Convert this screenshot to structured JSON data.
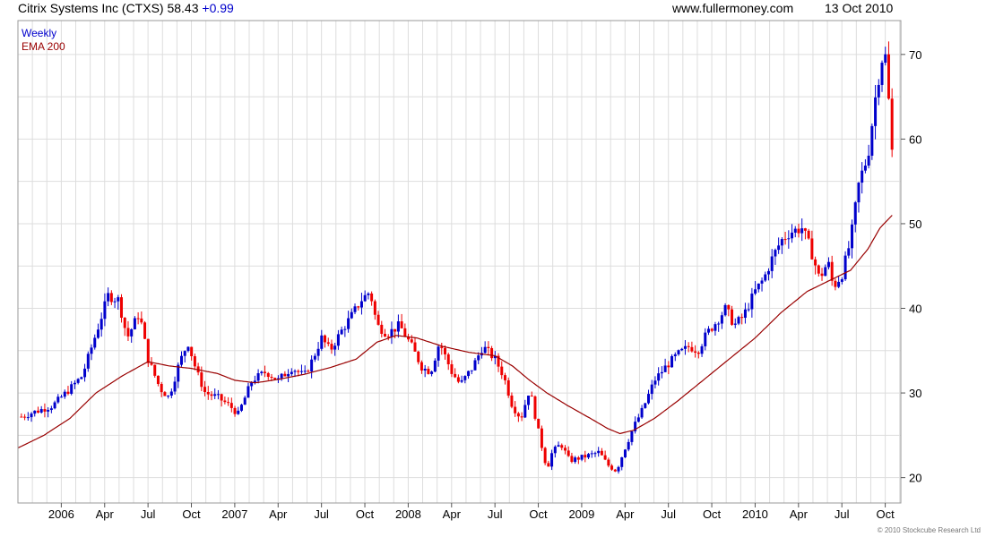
{
  "header": {
    "title": "Citrix Systems Inc (CTXS) 58.43",
    "change": "+0.99",
    "site": "www.fullermoney.com",
    "date": "13 Oct 2010"
  },
  "footer": {
    "copyright": "© 2010 Stockcube Research Ltd"
  },
  "colors": {
    "up": "#0000cc",
    "down": "#ee0000",
    "ema": "#990000",
    "grid": "#dddddd"
  },
  "chart_data": {
    "type": "candlestick",
    "legend": [
      "Weekly",
      "EMA 200"
    ],
    "legend_position": "top-left",
    "grid": true,
    "ylim": [
      17,
      74
    ],
    "y_ticks": [
      20,
      30,
      40,
      50,
      60,
      70
    ],
    "xlim": [
      2005.75,
      2010.84
    ],
    "x_ticks": [
      {
        "label": "2006",
        "x": 2006.0
      },
      {
        "label": "Apr",
        "x": 2006.25
      },
      {
        "label": "Jul",
        "x": 2006.5
      },
      {
        "label": "Oct",
        "x": 2006.75
      },
      {
        "label": "2007",
        "x": 2007.0
      },
      {
        "label": "Apr",
        "x": 2007.25
      },
      {
        "label": "Jul",
        "x": 2007.5
      },
      {
        "label": "Oct",
        "x": 2007.75
      },
      {
        "label": "2008",
        "x": 2008.0
      },
      {
        "label": "Apr",
        "x": 2008.25
      },
      {
        "label": "Jul",
        "x": 2008.5
      },
      {
        "label": "Oct",
        "x": 2008.75
      },
      {
        "label": "2009",
        "x": 2009.0
      },
      {
        "label": "Apr",
        "x": 2009.25
      },
      {
        "label": "Jul",
        "x": 2009.5
      },
      {
        "label": "Oct",
        "x": 2009.75
      },
      {
        "label": "2010",
        "x": 2010.0
      },
      {
        "label": "Apr",
        "x": 2010.25
      },
      {
        "label": "Jul",
        "x": 2010.5
      },
      {
        "label": "Oct",
        "x": 2010.75
      }
    ],
    "price_keypoints": [
      [
        2005.77,
        27.2
      ],
      [
        2005.85,
        27.8
      ],
      [
        2005.95,
        28.5
      ],
      [
        2006.05,
        30.5
      ],
      [
        2006.12,
        32.0
      ],
      [
        2006.2,
        37.0
      ],
      [
        2006.27,
        41.5
      ],
      [
        2006.33,
        41.0
      ],
      [
        2006.38,
        36.5
      ],
      [
        2006.45,
        39.5
      ],
      [
        2006.5,
        34.0
      ],
      [
        2006.57,
        30.5
      ],
      [
        2006.62,
        29.5
      ],
      [
        2006.68,
        33.5
      ],
      [
        2006.73,
        36.0
      ],
      [
        2006.78,
        32.5
      ],
      [
        2006.83,
        30.0
      ],
      [
        2006.9,
        29.5
      ],
      [
        2006.97,
        28.5
      ],
      [
        2007.02,
        27.5
      ],
      [
        2007.1,
        31.5
      ],
      [
        2007.18,
        32.5
      ],
      [
        2007.25,
        31.5
      ],
      [
        2007.33,
        33.0
      ],
      [
        2007.4,
        32.0
      ],
      [
        2007.45,
        34.0
      ],
      [
        2007.5,
        36.5
      ],
      [
        2007.55,
        35.0
      ],
      [
        2007.62,
        37.5
      ],
      [
        2007.67,
        39.0
      ],
      [
        2007.73,
        41.0
      ],
      [
        2007.78,
        42.0
      ],
      [
        2007.82,
        38.0
      ],
      [
        2007.88,
        37.0
      ],
      [
        2007.95,
        38.0
      ],
      [
        2008.02,
        35.5
      ],
      [
        2008.08,
        33.0
      ],
      [
        2008.13,
        32.5
      ],
      [
        2008.18,
        36.0
      ],
      [
        2008.25,
        32.5
      ],
      [
        2008.3,
        31.0
      ],
      [
        2008.37,
        33.0
      ],
      [
        2008.43,
        35.5
      ],
      [
        2008.5,
        34.0
      ],
      [
        2008.55,
        32.0
      ],
      [
        2008.6,
        28.5
      ],
      [
        2008.65,
        27.0
      ],
      [
        2008.7,
        30.5
      ],
      [
        2008.75,
        25.5
      ],
      [
        2008.8,
        21.0
      ],
      [
        2008.83,
        23.0
      ],
      [
        2008.88,
        24.0
      ],
      [
        2008.93,
        22.0
      ],
      [
        2009.02,
        22.5
      ],
      [
        2009.1,
        23.0
      ],
      [
        2009.15,
        21.5
      ],
      [
        2009.2,
        20.8
      ],
      [
        2009.25,
        23.5
      ],
      [
        2009.3,
        26.0
      ],
      [
        2009.35,
        28.0
      ],
      [
        2009.42,
        31.5
      ],
      [
        2009.48,
        33.0
      ],
      [
        2009.55,
        34.5
      ],
      [
        2009.62,
        35.5
      ],
      [
        2009.67,
        35.0
      ],
      [
        2009.72,
        37.0
      ],
      [
        2009.78,
        38.5
      ],
      [
        2009.83,
        40.0
      ],
      [
        2009.88,
        38.0
      ],
      [
        2009.93,
        39.0
      ],
      [
        2010.0,
        42.0
      ],
      [
        2010.05,
        43.5
      ],
      [
        2010.1,
        46.0
      ],
      [
        2010.15,
        48.0
      ],
      [
        2010.2,
        49.0
      ],
      [
        2010.27,
        49.5
      ],
      [
        2010.32,
        47.0
      ],
      [
        2010.37,
        43.5
      ],
      [
        2010.42,
        45.5
      ],
      [
        2010.45,
        42.5
      ],
      [
        2010.5,
        44.0
      ],
      [
        2010.55,
        48.0
      ],
      [
        2010.6,
        55.0
      ],
      [
        2010.65,
        58.0
      ],
      [
        2010.7,
        66.0
      ],
      [
        2010.74,
        70.5
      ],
      [
        2010.76,
        69.0
      ],
      [
        2010.78,
        60.0
      ],
      [
        2010.79,
        58.4
      ]
    ],
    "ema_keypoints": [
      [
        2005.75,
        23.5
      ],
      [
        2005.9,
        25.0
      ],
      [
        2006.05,
        27.0
      ],
      [
        2006.2,
        30.0
      ],
      [
        2006.35,
        32.0
      ],
      [
        2006.5,
        33.7
      ],
      [
        2006.62,
        33.2
      ],
      [
        2006.75,
        32.9
      ],
      [
        2006.9,
        32.3
      ],
      [
        2007.0,
        31.5
      ],
      [
        2007.12,
        31.2
      ],
      [
        2007.25,
        31.6
      ],
      [
        2007.4,
        32.2
      ],
      [
        2007.55,
        33.0
      ],
      [
        2007.7,
        34.0
      ],
      [
        2007.82,
        36.0
      ],
      [
        2007.93,
        36.8
      ],
      [
        2008.05,
        36.5
      ],
      [
        2008.2,
        35.5
      ],
      [
        2008.35,
        34.8
      ],
      [
        2008.5,
        34.4
      ],
      [
        2008.6,
        33.2
      ],
      [
        2008.7,
        31.5
      ],
      [
        2008.8,
        30.0
      ],
      [
        2008.92,
        28.5
      ],
      [
        2009.05,
        27.0
      ],
      [
        2009.15,
        25.8
      ],
      [
        2009.22,
        25.2
      ],
      [
        2009.3,
        25.6
      ],
      [
        2009.42,
        27.0
      ],
      [
        2009.55,
        29.0
      ],
      [
        2009.7,
        31.5
      ],
      [
        2009.85,
        34.0
      ],
      [
        2010.0,
        36.5
      ],
      [
        2010.15,
        39.5
      ],
      [
        2010.3,
        42.0
      ],
      [
        2010.45,
        43.5
      ],
      [
        2010.55,
        44.5
      ],
      [
        2010.65,
        47.0
      ],
      [
        2010.72,
        49.5
      ],
      [
        2010.79,
        51.0
      ]
    ]
  }
}
